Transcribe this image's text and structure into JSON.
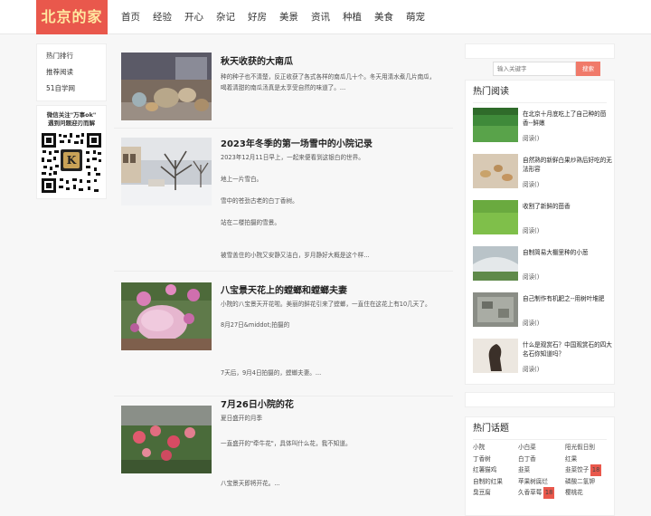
{
  "logo": "北京的家",
  "nav": [
    "首页",
    "经验",
    "开心",
    "杂记",
    "好房",
    "美景",
    "资讯",
    "种植",
    "美食",
    "萌宠"
  ],
  "left_sidebar": {
    "menu": [
      "热门排行",
      "推荐阅读",
      "51自学网"
    ],
    "qr_text_1": "微信关注\"万事ok\"",
    "qr_text_2": "遇到问题迎刃而解"
  },
  "articles": [
    {
      "title": "秋天收获的大南瓜",
      "lines": [
        "种的种子也不清楚，反正收获了各式各样的南瓜几十个。冬天用清水煮几片南瓜，",
        "喝着清甜的南瓜汤真是太享受自然的味道了。..."
      ]
    },
    {
      "title": "2023年冬季的第一场雪中的小院记录",
      "lines": [
        "2023年12月11日早上，一起来便看到这银白的世界。",
        "",
        "地上一片雪白。",
        "",
        "雪中的苍劲古老的白丁香树。",
        "",
        "站在二楼拍摄的雪景。",
        "",
        "",
        "被雪盖住的小院又安静又洁白，岁月静好大概是这个样..."
      ]
    },
    {
      "title": "八宝景天花上的螳螂和螳螂夫妻",
      "lines": [
        "小院的八宝景天开花啦。美丽的鲜花引来了螳螂，一直住在这花上有10几天了。",
        "",
        "8月27日&middot;拍摄的",
        "",
        "",
        "",
        "",
        "7天后，9月4日拍摄的，螳螂夫妻。..."
      ]
    },
    {
      "title": "7月26日小院的花",
      "lines": [
        "夏日盛开的月季",
        "",
        "",
        "一直盛开的\"牵牛花\"，具体叫什么花，我不知道。",
        "",
        "",
        "",
        "八宝景天即将开花。..."
      ]
    }
  ],
  "search": {
    "placeholder": "输入关键字",
    "button": "搜索"
  },
  "hot_reading": {
    "title": "热门阅读",
    "items": [
      {
        "title": "在北京十月底吃上了自己种的茴香--鲜嫩",
        "count": "阅读()"
      },
      {
        "title": "自然熟的新鲜白果炒熟后好吃的无法形容",
        "count": "阅读()"
      },
      {
        "title": "收割了新鲜的茴香",
        "count": "阅读()"
      },
      {
        "title": "自制简易大棚里种的小葱",
        "count": "阅读()"
      },
      {
        "title": "自己制作有机肥之--用树叶堆肥",
        "count": "阅读()"
      },
      {
        "title": "什么是观赏石？中国观赏石的四大名石你知道吗？",
        "count": "阅读()"
      }
    ]
  },
  "hot_topics": {
    "title": "热门话题",
    "items": [
      {
        "label": "小院",
        "badge": ""
      },
      {
        "label": "小白菜",
        "badge": ""
      },
      {
        "label": "阳光假日别",
        "badge": ""
      },
      {
        "label": "丁香树",
        "badge": ""
      },
      {
        "label": "白丁香",
        "badge": ""
      },
      {
        "label": "红果",
        "badge": ""
      },
      {
        "label": "红薯猫鸡",
        "badge": ""
      },
      {
        "label": "韭菜",
        "badge": ""
      },
      {
        "label": "韭菜饺子",
        "badge": "18"
      },
      {
        "label": "自制的红果",
        "badge": ""
      },
      {
        "label": "苹果树腐烂",
        "badge": ""
      },
      {
        "label": "磷酸二氢钾",
        "badge": ""
      },
      {
        "label": "臭豆腐",
        "badge": ""
      },
      {
        "label": "久香草莓",
        "badge": "18"
      },
      {
        "label": "樱桃花",
        "badge": ""
      }
    ]
  },
  "colors": {
    "logo_bg": "#e9584c",
    "logo_text": "#ffe8a0",
    "search_button": "#f07a6a"
  }
}
